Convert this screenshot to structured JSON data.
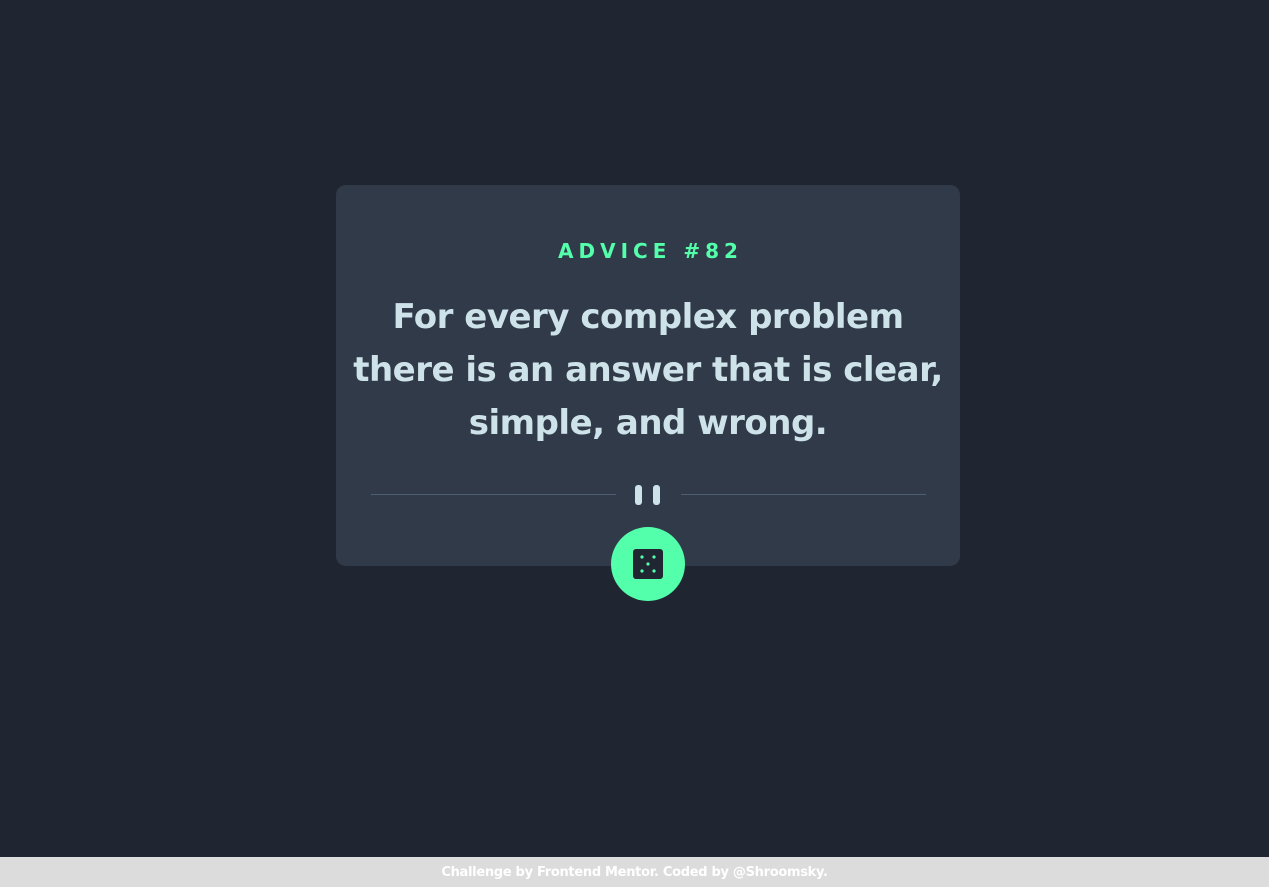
{
  "card": {
    "advice_label": "ADVICE #82",
    "advice_text": "For every complex problem there is an answer that is clear, simple, and wrong."
  },
  "divider": {
    "icon": "pause-icon"
  },
  "button": {
    "icon": "dice-icon"
  },
  "footer": {
    "prefix": "Challenge by",
    "link_mentor": "Frontend Mentor",
    "middle": ". Coded by",
    "link_author": "@Shroomsky",
    "suffix": "."
  },
  "colors": {
    "background": "#1f2632",
    "card": "#313a49",
    "accent": "#53ffaa",
    "text": "#cee3e9",
    "footer_bg": "#dcdcdc"
  }
}
